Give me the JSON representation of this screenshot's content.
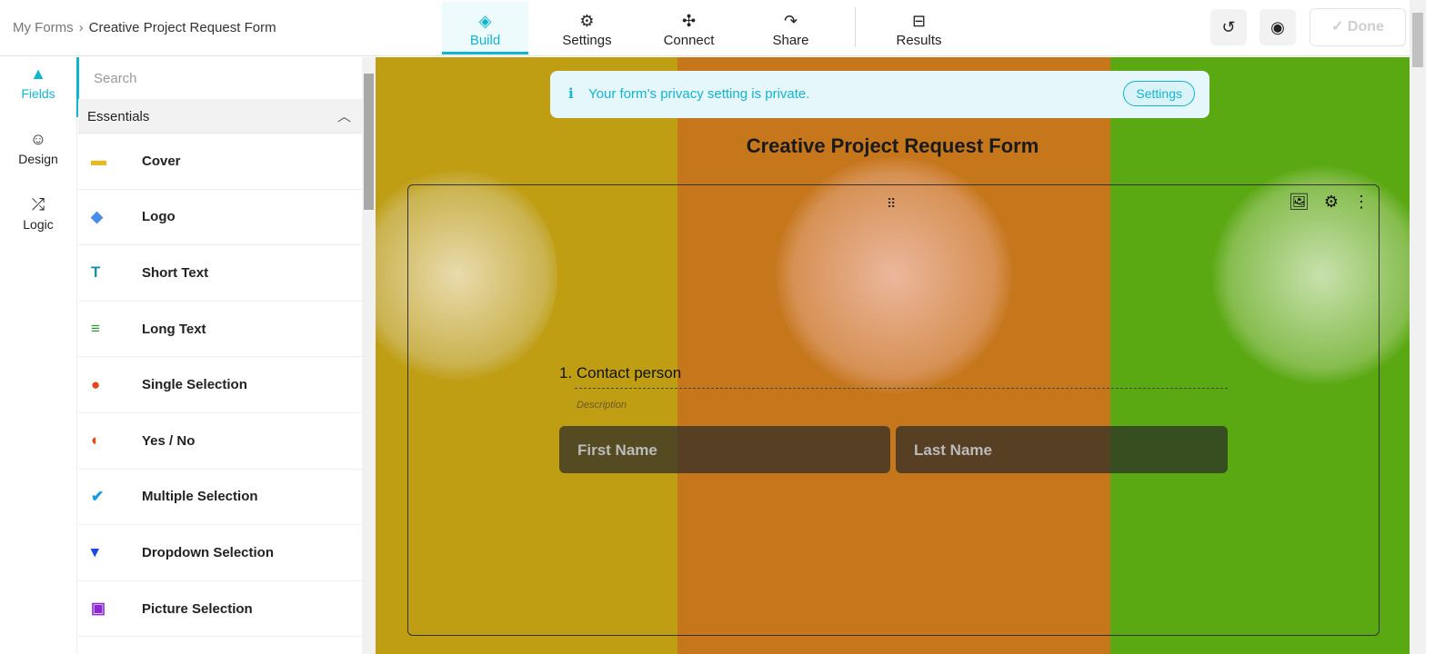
{
  "breadcrumb": {
    "root": "My Forms",
    "separator": "›",
    "current": "Creative Project Request Form"
  },
  "tabs": [
    {
      "label": "Build",
      "icon": "layers-icon"
    },
    {
      "label": "Settings",
      "icon": "gear-icon"
    },
    {
      "label": "Connect",
      "icon": "puzzle-icon"
    },
    {
      "label": "Share",
      "icon": "share-arrow-icon"
    },
    {
      "label": "Results",
      "icon": "inbox-icon"
    }
  ],
  "actions": {
    "done": "Done"
  },
  "sidebar": [
    {
      "label": "Fields"
    },
    {
      "label": "Design"
    },
    {
      "label": "Logic"
    }
  ],
  "panel": {
    "search_placeholder": "Search",
    "section": "Essentials",
    "items": [
      {
        "label": "Cover",
        "color": "#e8b923"
      },
      {
        "label": "Logo",
        "color": "#4a8de8"
      },
      {
        "label": "Short Text",
        "color": "#1a8fa8"
      },
      {
        "label": "Long Text",
        "color": "#2a9a3a"
      },
      {
        "label": "Single Selection",
        "color": "#e04a1a"
      },
      {
        "label": "Yes / No",
        "color": "#e04a1a"
      },
      {
        "label": "Multiple Selection",
        "color": "#1a9ae0"
      },
      {
        "label": "Dropdown Selection",
        "color": "#1a4ae0"
      },
      {
        "label": "Picture Selection",
        "color": "#8a2ad0"
      }
    ]
  },
  "notice": {
    "text": "Your form’s privacy setting is private.",
    "button": "Settings"
  },
  "form": {
    "title": "Creative Project Request Form",
    "question": "1. Contact person",
    "description": "Description",
    "first_name": "First Name",
    "last_name": "Last Name"
  }
}
